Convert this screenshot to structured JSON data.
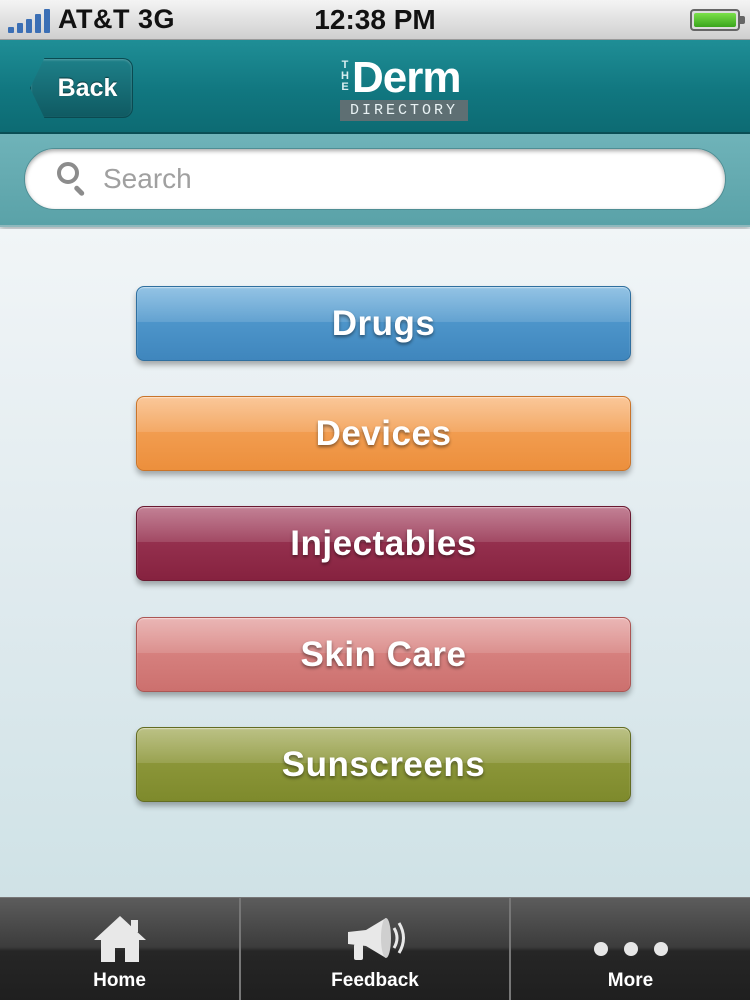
{
  "status_bar": {
    "carrier": "AT&T",
    "network": "3G",
    "time": "12:38 PM",
    "battery_level": 1.0
  },
  "nav_bar": {
    "back_label": "Back",
    "logo": {
      "the": [
        "T",
        "H",
        "E"
      ],
      "name": "Derm",
      "sub": "DIRECTORY"
    }
  },
  "search": {
    "placeholder": "Search",
    "value": ""
  },
  "categories": [
    {
      "label": "Drugs",
      "color": "#4a93c9"
    },
    {
      "label": "Devices",
      "color": "#f09a4a"
    },
    {
      "label": "Injectables",
      "color": "#8f2b48"
    },
    {
      "label": "Skin Care",
      "color": "#d47c7a"
    },
    {
      "label": "Sunscreens",
      "color": "#879433"
    }
  ],
  "tab_bar": {
    "tabs": [
      {
        "label": "Home",
        "icon": "home-icon"
      },
      {
        "label": "Feedback",
        "icon": "megaphone-icon"
      },
      {
        "label": "More",
        "icon": "more-dots-icon"
      }
    ]
  }
}
